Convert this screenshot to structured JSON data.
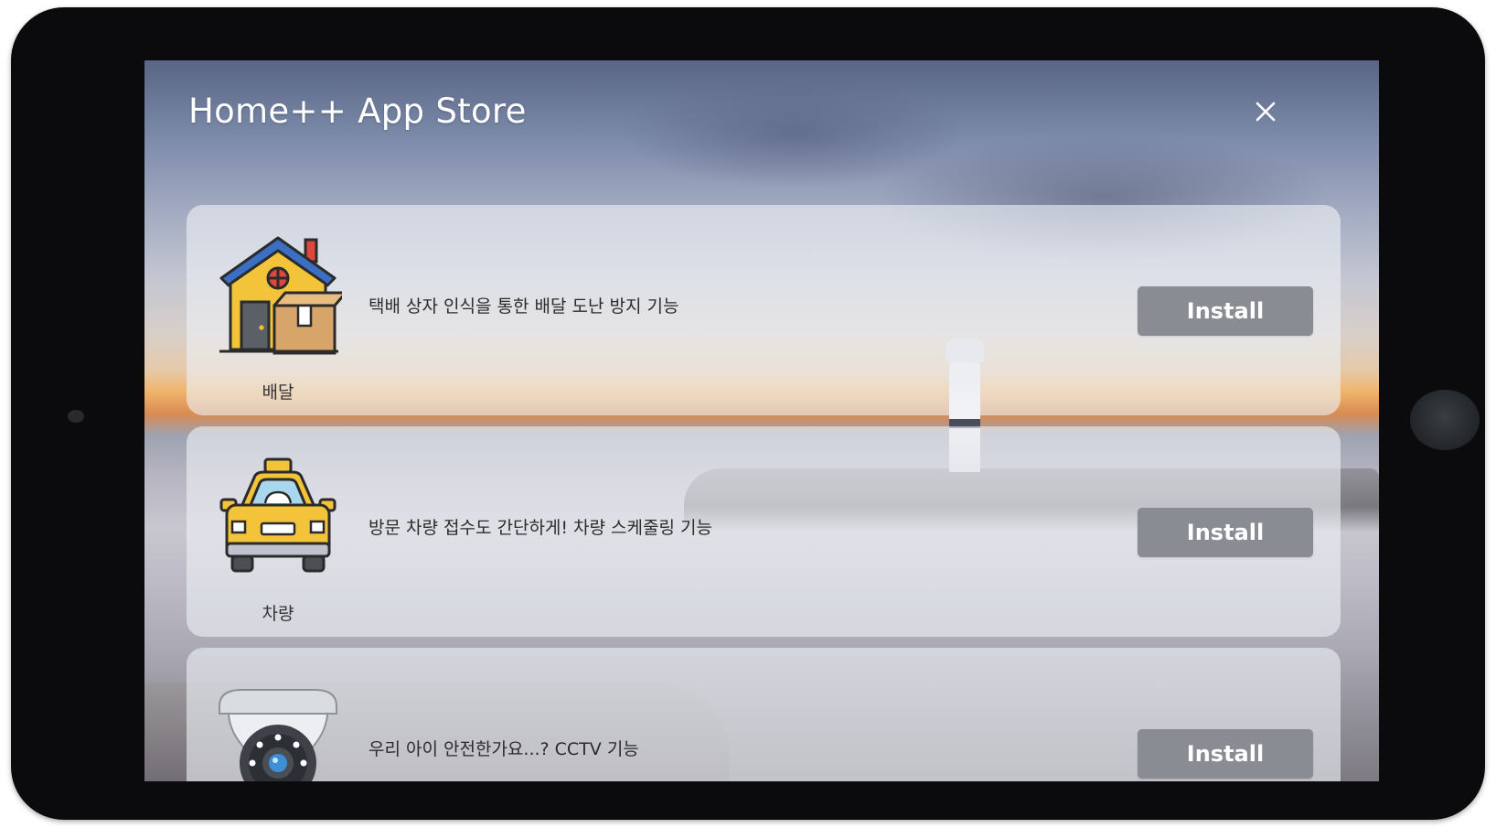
{
  "store": {
    "title": "Home++ App Store",
    "close_icon": "close-icon"
  },
  "apps": [
    {
      "name": "배달",
      "description": "택배 상자 인식을 통한 배달 도난 방지 기능",
      "install_label": "Install",
      "icon": "house-package-icon"
    },
    {
      "name": "차량",
      "description": "방문 차량 접수도 간단하게! 차량 스케줄링 기능",
      "install_label": "Install",
      "icon": "taxi-car-icon"
    },
    {
      "name": "",
      "description": "우리 아이 안전한가요...? CCTV 기능",
      "install_label": "Install",
      "icon": "cctv-camera-icon"
    }
  ],
  "colors": {
    "install_button": "#8a8c93",
    "card_background": "rgba(238,240,246,0.62)"
  }
}
